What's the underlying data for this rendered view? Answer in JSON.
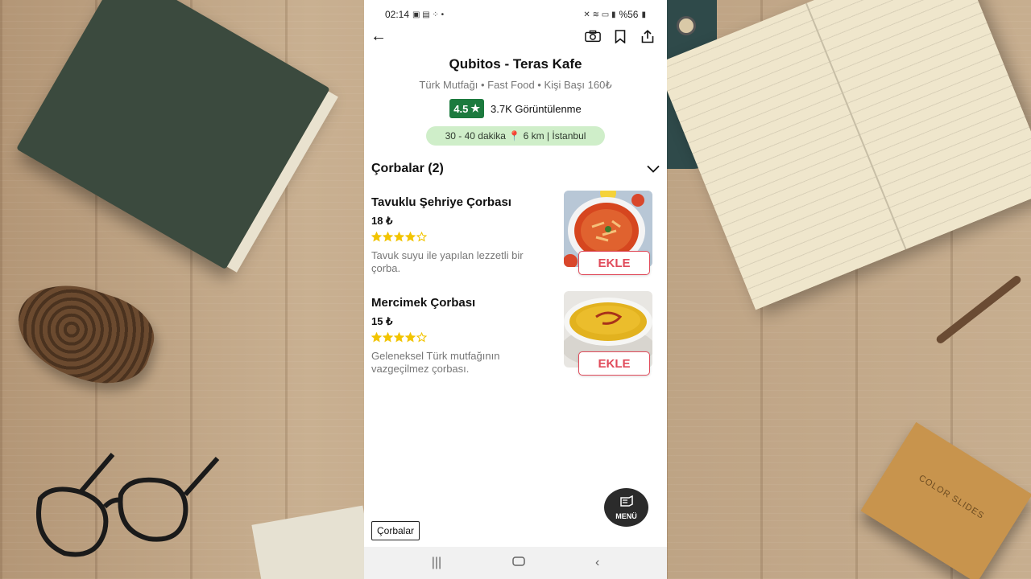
{
  "status_bar": {
    "time": "02:14",
    "battery": "%56"
  },
  "restaurant": {
    "name": "Qubitos - Teras Kafe",
    "meta": "Türk Mutfağı • Fast Food • Kişi Başı 160₺",
    "rating": "4.5",
    "views": "3.7K Görüntülenme",
    "delivery": "30 - 40 dakika 📍 6 km | İstanbul"
  },
  "section": {
    "title": "Çorbalar (2)"
  },
  "items": [
    {
      "name": "Tavuklu Şehriye Çorbası",
      "price": "18 ₺",
      "rating_stars": 4,
      "rating_max": 5,
      "description": "Tavuk suyu ile yapılan lezzetli bir çorba.",
      "add_label": "EKLE"
    },
    {
      "name": "Mercimek Çorbası",
      "price": "15 ₺",
      "rating_stars": 4,
      "rating_max": 5,
      "description": "Geleneksel Türk mutfağının vazgeçilmez çorbası.",
      "add_label": "EKLE"
    }
  ],
  "menu_fab": {
    "label": "MENÜ"
  },
  "category_chip": {
    "label": "Çorbalar"
  },
  "colors": {
    "rating_badge": "#1c7a3e",
    "delivery_pill": "#cfeec9",
    "add_button": "#e04a5a",
    "star": "#f2c400"
  },
  "icons": {
    "back": "arrow-left-icon",
    "camera": "camera-icon",
    "bookmark": "bookmark-icon",
    "share": "share-icon",
    "chevron": "chevron-down-icon",
    "menu_fab": "menu-book-icon"
  }
}
